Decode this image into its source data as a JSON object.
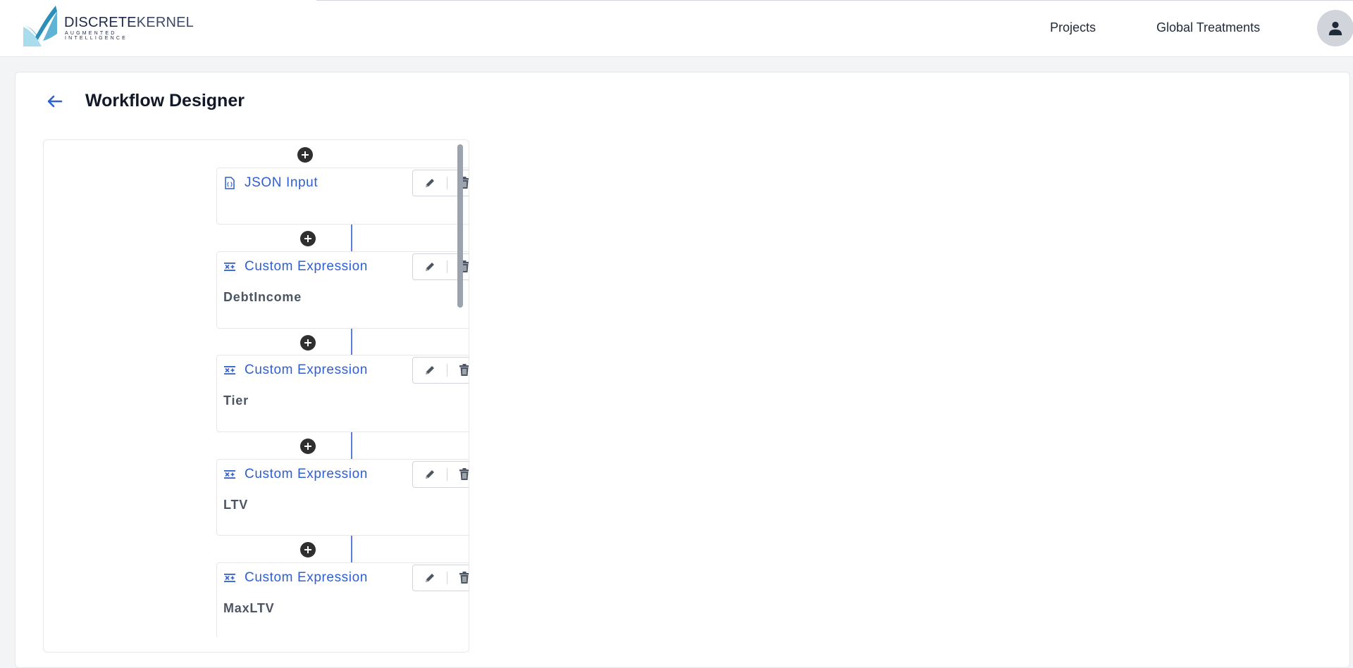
{
  "app": {
    "brand_bold": "DISCRETE",
    "brand_light": "KERNEL",
    "tagline": "AUGMENTED INTELLIGENCE"
  },
  "nav": {
    "projects": "Projects",
    "global_treatments": "Global Treatments"
  },
  "page": {
    "title": "Workflow Designer"
  },
  "workflow": {
    "nodes": [
      {
        "type": "JSON Input",
        "name": "",
        "icon": "json-file-icon"
      },
      {
        "type": "Custom Expression",
        "name": "DebtIncome",
        "icon": "expression-icon"
      },
      {
        "type": "Custom Expression",
        "name": "Tier",
        "icon": "expression-icon"
      },
      {
        "type": "Custom Expression",
        "name": "LTV",
        "icon": "expression-icon"
      },
      {
        "type": "Custom Expression",
        "name": "MaxLTV",
        "icon": "expression-icon"
      }
    ]
  },
  "colors": {
    "accent": "#2f5fd0",
    "connector": "#5b7fd6",
    "plus_button": "#2f2f2f",
    "page_bg": "#f3f4f6"
  }
}
